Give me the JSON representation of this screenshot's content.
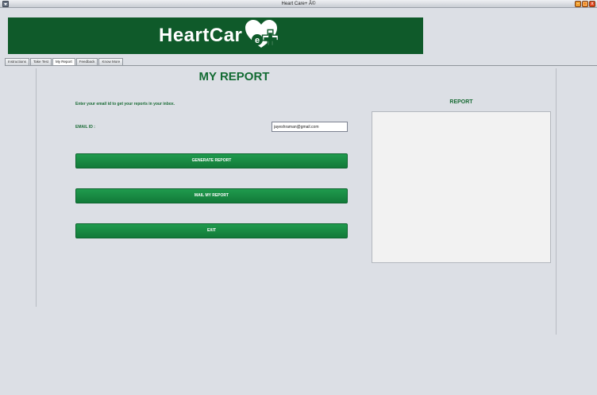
{
  "window": {
    "title": "Heart Care+ Â©",
    "minimize_label": "–",
    "maximize_label": "□",
    "close_label": "x"
  },
  "banner": {
    "brand": "HeartCar",
    "logo_letter": "e",
    "colors": {
      "background": "#0f5a2a",
      "heart": "#ffffff",
      "cross": "#ffffff"
    }
  },
  "tabs": [
    {
      "label": "Instructions",
      "active": false
    },
    {
      "label": "Take Test",
      "active": false
    },
    {
      "label": "My Report",
      "active": true
    },
    {
      "label": "Feedback",
      "active": false
    },
    {
      "label": "Know More",
      "active": false
    }
  ],
  "main": {
    "title": "MY REPORT",
    "instructions": "Enter your email id to get your reports in your inbox.",
    "email_label": "EMAIL ID  :",
    "email_value": "jayeshraman@gmail.com",
    "buttons": {
      "generate": "GENERATE REPORT",
      "mail": "MAIL MY REPORT",
      "exit": "EXIT"
    },
    "report_label": "REPORT",
    "report_text": ""
  },
  "colors": {
    "accent": "#136b33",
    "button": "#1a8a44",
    "panel": "#dcdfe5"
  }
}
